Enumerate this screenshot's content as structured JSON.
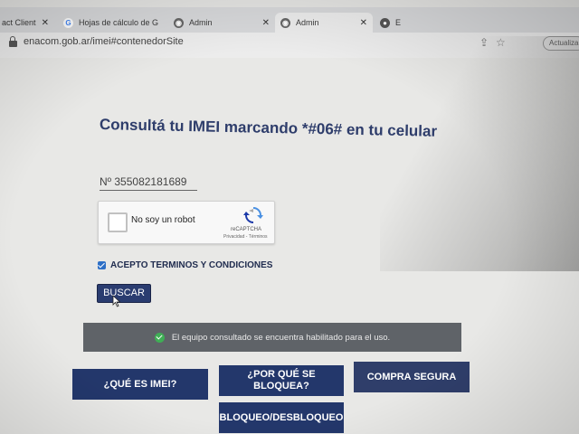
{
  "browser": {
    "tabs": [
      {
        "label": "act Client",
        "icon": "doc-icon"
      },
      {
        "label": "Hojas de cálculo de G",
        "icon": "google-icon"
      },
      {
        "label": "Admin",
        "icon": "admin-icon"
      },
      {
        "label": "Admin",
        "icon": "admin-icon"
      },
      {
        "label": "E",
        "icon": "tab-icon"
      }
    ],
    "url": "enacom.gob.ar/imei#contenedorSite",
    "update_label": "Actualiza",
    "new_tab": "+"
  },
  "page": {
    "title": "Consultá tu IMEI marcando *#06# en tu celular",
    "imei_field": "Nº  355082181689",
    "captcha": {
      "label": "No soy un robot",
      "brand": "reCAPTCHA",
      "links": "Privacidad - Términos"
    },
    "accept_terms": "ACEPTO TERMINOS Y CONDICIONES",
    "search_button": "BUSCAR",
    "status_message": "El equipo consultado se encuentra habilitado para el uso.",
    "buttons": {
      "que_es": "¿QUÉ ES IMEI?",
      "por_que": "¿POR QUÉ SE BLOQUEA?",
      "compra": "COMPRA SEGURA",
      "bloqueo": "BLOQUEO/DESBLOQUEO"
    }
  }
}
